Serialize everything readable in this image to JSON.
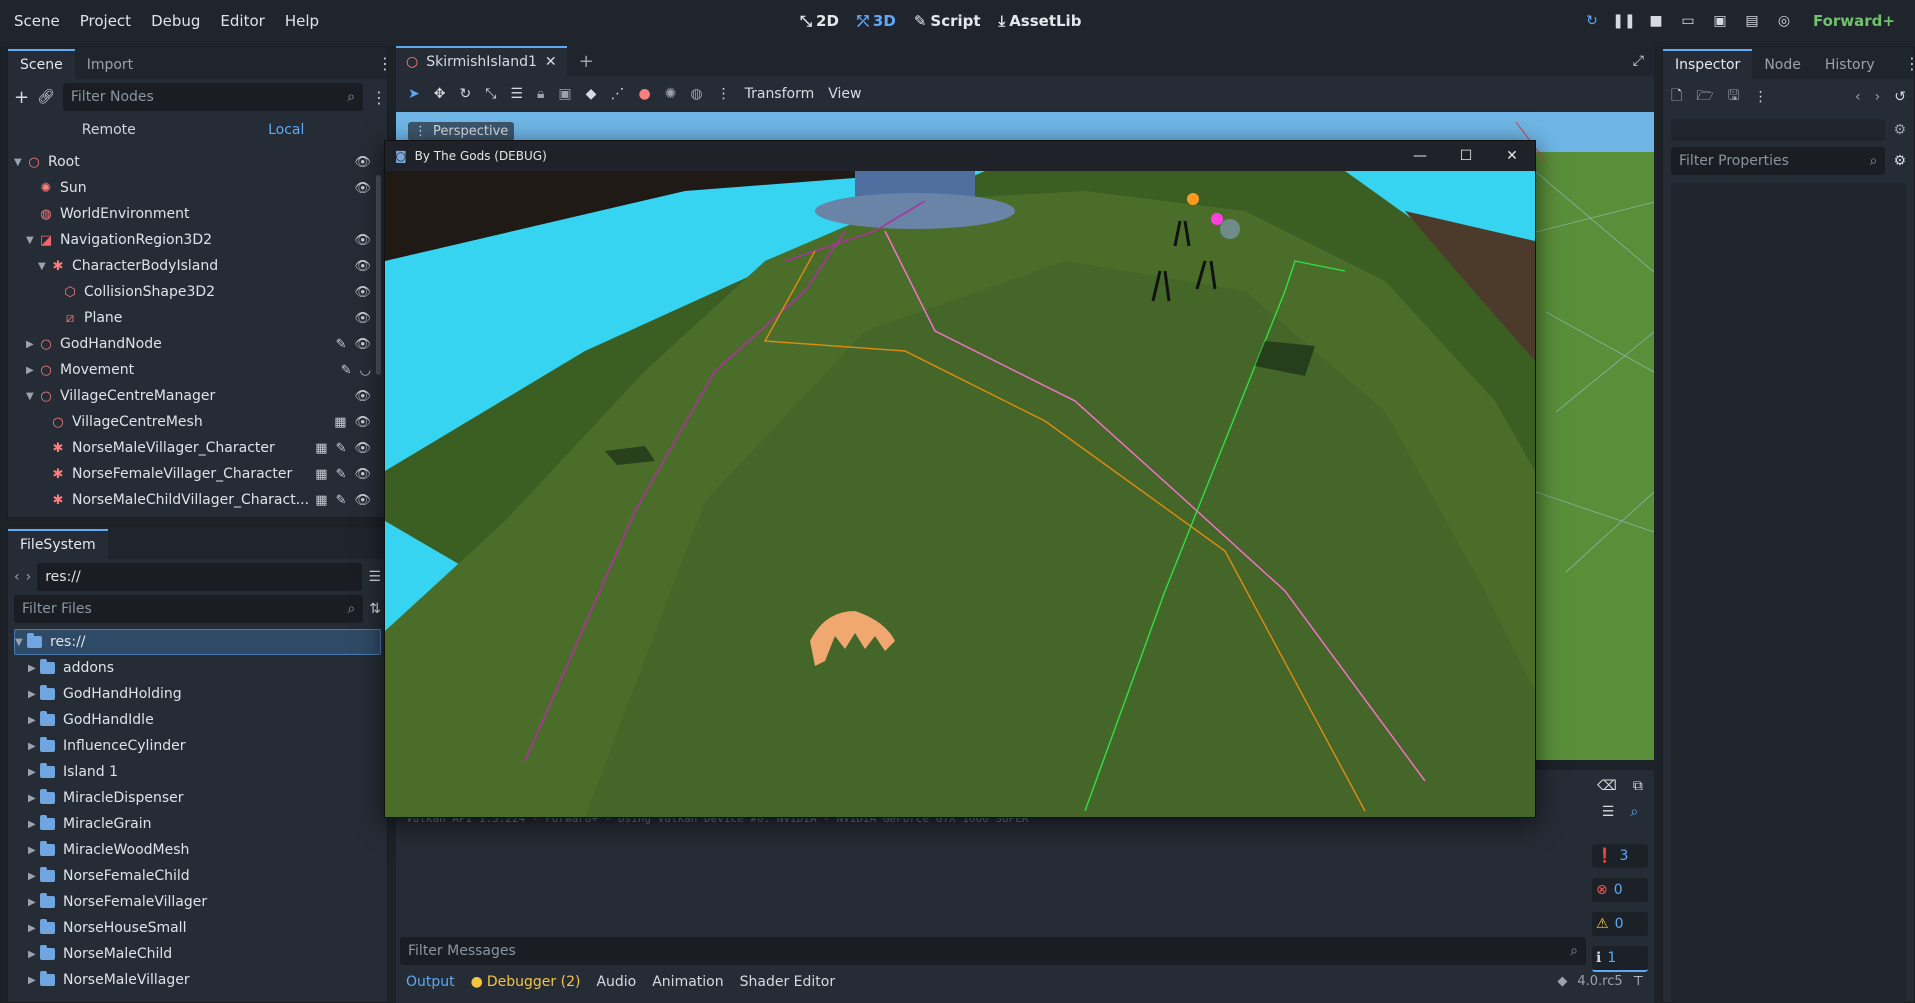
{
  "menubar": {
    "items": [
      "Scene",
      "Project",
      "Debug",
      "Editor",
      "Help"
    ],
    "workspaces": [
      "2D",
      "3D",
      "Script",
      "AssetLib"
    ],
    "active_workspace": "3D",
    "renderer": "Forward+"
  },
  "scene_dock": {
    "tabs": [
      "Scene",
      "Import"
    ],
    "filter_placeholder": "Filter Nodes",
    "remote_label": "Remote",
    "local_label": "Local",
    "nodes": [
      {
        "label": "Root",
        "depth": 0,
        "icon": "node3d-icon",
        "expanded": true
      },
      {
        "label": "Sun",
        "depth": 1,
        "icon": "light-icon"
      },
      {
        "label": "WorldEnvironment",
        "depth": 1,
        "icon": "globe-icon"
      },
      {
        "label": "NavigationRegion3D2",
        "depth": 1,
        "icon": "navregion-icon",
        "expanded": true
      },
      {
        "label": "CharacterBodyIsland",
        "depth": 2,
        "icon": "character-icon",
        "expanded": true
      },
      {
        "label": "CollisionShape3D2",
        "depth": 3,
        "icon": "collision-icon"
      },
      {
        "label": "Plane",
        "depth": 3,
        "icon": "mesh-icon"
      },
      {
        "label": "GodHandNode",
        "depth": 1,
        "icon": "node3d-icon",
        "collapsed": true
      },
      {
        "label": "Movement",
        "depth": 1,
        "icon": "node3d-icon",
        "collapsed": true
      },
      {
        "label": "VillageCentreManager",
        "depth": 1,
        "icon": "node3d-icon",
        "expanded": true
      },
      {
        "label": "VillageCentreMesh",
        "depth": 2,
        "icon": "node3d-icon"
      },
      {
        "label": "NorseMaleVillager_Character",
        "depth": 2,
        "icon": "character-icon"
      },
      {
        "label": "NorseFemaleVillager_Character",
        "depth": 2,
        "icon": "character-icon"
      },
      {
        "label": "NorseMaleChildVillager_Charact...",
        "depth": 2,
        "icon": "character-icon"
      }
    ]
  },
  "filesystem": {
    "tab": "FileSystem",
    "path": "res://",
    "filter_placeholder": "Filter Files",
    "root": "res://",
    "folders": [
      "addons",
      "GodHandHolding",
      "GodHandIdle",
      "InfluenceCylinder",
      "Island 1",
      "MiracleDispenser",
      "MiracleGrain",
      "MiracleWoodMesh",
      "NorseFemaleChild",
      "NorseFemaleVillager",
      "NorseHouseSmall",
      "NorseMaleChild",
      "NorseMaleVillager"
    ]
  },
  "editor": {
    "scene_tab": "SkirmishIsland1",
    "viewport_label": "Perspective",
    "toolbar": {
      "transform_menu": "Transform",
      "view_menu": "View"
    }
  },
  "game_window": {
    "title": "By The Gods (DEBUG)"
  },
  "bottom_panel": {
    "log_text": "Vulkan API 1.3.224 - Forward+ - Using Vulkan Device #0: NVIDIA - NVIDIA GeForce GTX 1660 SUPER",
    "filter_placeholder": "Filter Messages",
    "tabs": [
      "Output",
      "Debugger (2)",
      "Audio",
      "Animation",
      "Shader Editor"
    ],
    "version": "4.0.rc5",
    "counters": {
      "messages": "3",
      "errors": "0",
      "warnings": "0",
      "info": "1"
    }
  },
  "inspector": {
    "tabs": [
      "Inspector",
      "Node",
      "History"
    ],
    "filter_placeholder": "Filter Properties"
  },
  "colors": {
    "accent": "#5fa8f2",
    "renderer": "#6fc36b",
    "node_icon": "#fc7f7f",
    "folder": "#6fa5e0",
    "error": "#f15a5a",
    "warning": "#f5c542"
  }
}
